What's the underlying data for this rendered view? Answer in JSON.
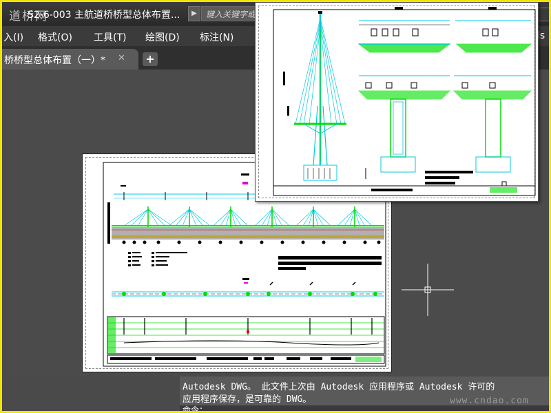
{
  "title_bar": {
    "watermark": "道桥网",
    "document_title": "S2-6-003 主航道桥桥型总体布置...",
    "search_placeholder": "键入关键字或短语"
  },
  "menu": {
    "items": [
      "入(I)",
      "格式(O)",
      "工具(T)",
      "绘图(D)",
      "标注(N)"
    ],
    "trailing": "ls"
  },
  "tabs": {
    "active_label": "桥桥型总体布置（一）*",
    "close_glyph": "✕",
    "new_tab_glyph": "+"
  },
  "command_line": {
    "history_line_1": "Autodesk DWG。  此文件上次由 Autodesk 应用程序或 Autodesk 许可的",
    "history_line_2": "应用程序保存，是可靠的 DWG。",
    "watermark": "www.cndao.com",
    "prompt": "命令："
  },
  "colors": {
    "frame_border": "#f2e300",
    "drawing_background": "#4b4b4b",
    "cad_green": "#00e000",
    "cad_cyan": "#00c8e0",
    "cad_magenta": "#e000e0"
  }
}
